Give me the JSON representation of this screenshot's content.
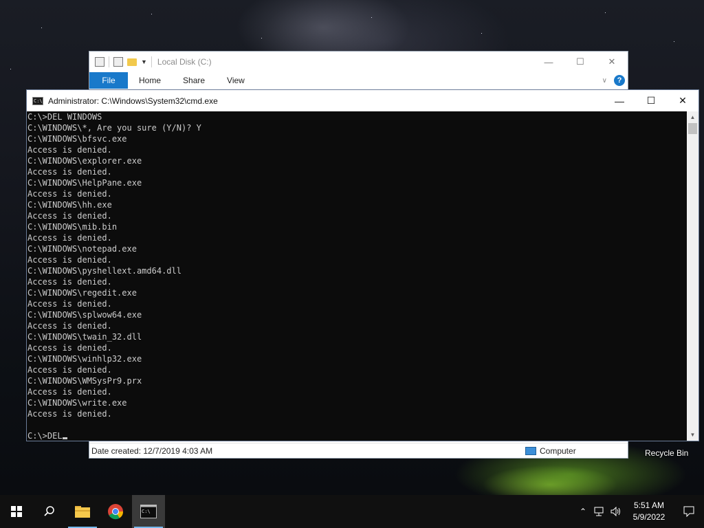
{
  "explorer": {
    "title": "Local Disk (C:)",
    "ribbon_tabs": [
      "File",
      "Home",
      "Share",
      "View"
    ],
    "status_date": "Date created: 12/7/2019 4:03 AM",
    "status_type": "Computer"
  },
  "cmd": {
    "title": "Administrator: C:\\Windows\\System32\\cmd.exe",
    "lines": [
      "C:\\>DEL WINDOWS",
      "C:\\WINDOWS\\*, Are you sure (Y/N)? Y",
      "C:\\WINDOWS\\bfsvc.exe",
      "Access is denied.",
      "C:\\WINDOWS\\explorer.exe",
      "Access is denied.",
      "C:\\WINDOWS\\HelpPane.exe",
      "Access is denied.",
      "C:\\WINDOWS\\hh.exe",
      "Access is denied.",
      "C:\\WINDOWS\\mib.bin",
      "Access is denied.",
      "C:\\WINDOWS\\notepad.exe",
      "Access is denied.",
      "C:\\WINDOWS\\pyshellext.amd64.dll",
      "Access is denied.",
      "C:\\WINDOWS\\regedit.exe",
      "Access is denied.",
      "C:\\WINDOWS\\splwow64.exe",
      "Access is denied.",
      "C:\\WINDOWS\\twain_32.dll",
      "Access is denied.",
      "C:\\WINDOWS\\winhlp32.exe",
      "Access is denied.",
      "C:\\WINDOWS\\WMSysPr9.prx",
      "Access is denied.",
      "C:\\WINDOWS\\write.exe",
      "Access is denied.",
      ""
    ],
    "prompt": "C:\\>DEL"
  },
  "desktop": {
    "recycle_bin_label": "Recycle Bin"
  },
  "taskbar": {
    "time": "5:51 AM",
    "date": "5/9/2022",
    "apps": [
      "start",
      "search",
      "file-explorer",
      "chrome",
      "cmd"
    ],
    "active_app": "cmd",
    "accent_color": "#76b9ed"
  }
}
